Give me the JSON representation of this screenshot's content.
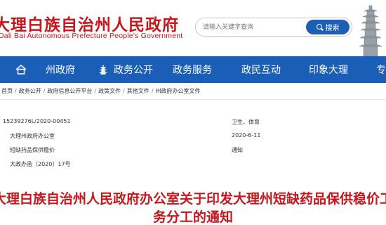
{
  "header": {
    "site_title": "大理白族自治州人民政府",
    "site_subtitle": "Dali Bai Autonomous Prefecture People's Government",
    "search_placeholder": "请输入关键字查询",
    "search_label": "搜索"
  },
  "nav": {
    "items": [
      {
        "label": "州政府",
        "icon": "home-icon"
      },
      {
        "label": "政务公开",
        "icon": "pagoda-icon"
      },
      {
        "label": "政务服务"
      },
      {
        "label": "政民互动"
      },
      {
        "label": "印象大理"
      },
      {
        "label": "专"
      }
    ]
  },
  "breadcrumb": {
    "items": [
      "首页",
      "政务公开",
      "政府信息公开平台",
      "政策文件",
      "其他文件",
      "州政府办公室文件"
    ],
    "separator": "/"
  },
  "meta": {
    "index_no": "15239276L/2020-00451",
    "topic": "卫生、体育",
    "publisher": "大理州政府办公室",
    "date": "2020-6-11",
    "title_short": "短缺药品保供稳价",
    "doc_type": "通知",
    "doc_no": "大政办函〔2020〕17号"
  },
  "document": {
    "title_line1": "大理白族自治州人民政府办公室关于印发大理州短缺药品保供稳价工",
    "title_line2": "务分工的通知"
  },
  "colors": {
    "brand_red": "#c8161d",
    "nav_blue": "#1b5eb8",
    "search_blue": "#1c5fb4"
  }
}
